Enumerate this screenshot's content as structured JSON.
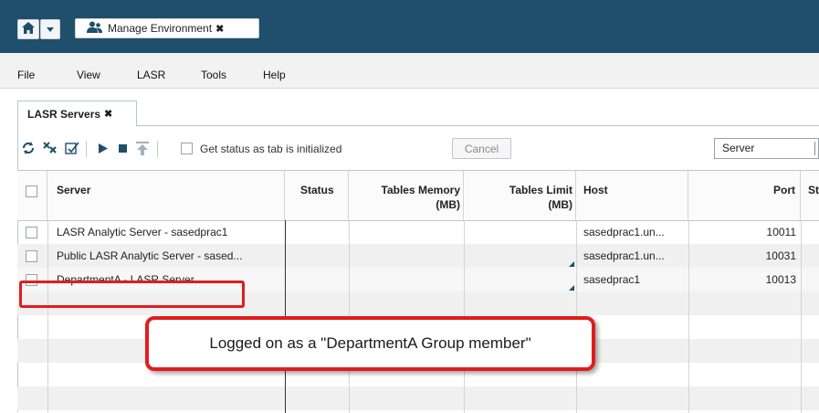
{
  "window": {
    "app_tab_title": "Manage Environment",
    "app_tab_close": "✖"
  },
  "menu": [
    "File",
    "View",
    "LASR",
    "Tools",
    "Help"
  ],
  "tab": {
    "label": "LASR Servers",
    "close": "✖"
  },
  "toolbar": {
    "status_checkbox_label": "Get status as tab is initialized",
    "cancel_label": "Cancel",
    "filter_select_value": "Server"
  },
  "table": {
    "columns": [
      "Server",
      "Status",
      "Tables Memory (MB)",
      "Tables Limit (MB)",
      "Host",
      "Port",
      "St"
    ],
    "column_header_lines": {
      "tables_memory": [
        "Tables Memory",
        "(MB)"
      ],
      "tables_limit": [
        "Tables Limit",
        "(MB)"
      ]
    },
    "rows": [
      {
        "server": "LASR Analytic Server - sasedprac1",
        "status": "",
        "memory": "",
        "limit": "",
        "host": "sasedprac1.un...",
        "port": "10011"
      },
      {
        "server": "Public LASR Analytic Server - sased...",
        "status": "",
        "memory": "",
        "limit": "",
        "host": "sasedprac1.un...",
        "port": "10031"
      },
      {
        "server": "DepartmentA - LASR Server",
        "status": "",
        "memory": "",
        "limit": "",
        "host": "sasedprac1",
        "port": "10013"
      }
    ]
  },
  "annotation": {
    "callout_text": "Logged on as a \"DepartmentA Group member\"",
    "highlight_color": "#e21c1c"
  },
  "colors": {
    "header_bar": "#1f4f6b",
    "accent": "#1f4f6b"
  }
}
